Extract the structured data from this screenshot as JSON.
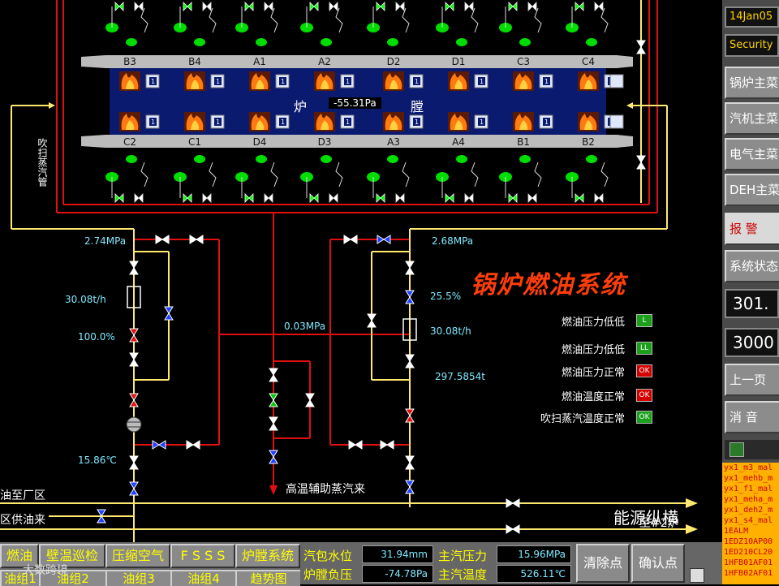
{
  "title": "锅炉燃油系统",
  "furnace": {
    "label_left": "炉",
    "label_right": "膛",
    "pressure": "-55.31Pa",
    "top_burners": [
      "B3",
      "B4",
      "A1",
      "A2",
      "D2",
      "D1",
      "C3",
      "C4"
    ],
    "bottom_burners": [
      "C2",
      "C1",
      "D4",
      "D3",
      "A3",
      "A4",
      "B1",
      "B2"
    ],
    "burner_value": "1"
  },
  "labels": {
    "purge_pipe": "吹扫蒸汽管",
    "aux_steam": "高温辅助蒸汽来",
    "to_plant": "油至厂区",
    "oil_supply": "区供油来",
    "to_boiler2": "至#2炉"
  },
  "readings": {
    "left_pressure": "2.74MPa",
    "left_flow": "30.08t/h",
    "left_valve_pct": "100.0%",
    "left_temp": "15.86℃",
    "mid_pressure": "0.03MPa",
    "right_pressure": "2.68MPa",
    "right_valve_pct": "25.5%",
    "right_flow": "30.08t/h",
    "right_total": "297.5854t"
  },
  "alarms": [
    {
      "text": "燃油压力低低",
      "badge": "L",
      "color": "#1aa01a"
    },
    {
      "text": "燃油压力低低",
      "badge": "LL",
      "color": "#1aa01a"
    },
    {
      "text": "燃油压力正常",
      "badge": "OK",
      "color": "#d40000"
    },
    {
      "text": "燃油温度正常",
      "badge": "OK",
      "color": "#d40000"
    },
    {
      "text": "吹扫蒸汽温度正常",
      "badge": "OK",
      "color": "#1aa01a"
    }
  ],
  "right_panel": {
    "date": "14Jan05",
    "security": "Security",
    "buttons": [
      "锅炉主菜",
      "汽机主菜",
      "电气主菜",
      "DEH主菜"
    ],
    "alarm_btn": "报  警",
    "status_btn": "系统状态",
    "value1": "301.",
    "value2": "3000",
    "prev_btn": "上一页",
    "silence_btn": "消  音",
    "events": [
      "yx1_m3_mal",
      "yx1_mehb_m",
      "yx1_f1_mal",
      "yx1_meha_m",
      "yx1_deh2_m",
      "yx1_s4_mal",
      "1EALM",
      "1EDZ10AP00",
      "1ED210CL20",
      "1HFB01AF01",
      "1HFB02AF01"
    ]
  },
  "bottom": {
    "btn1": "燃油",
    "btn2": "壁温巡检",
    "btn3": "压缩空气",
    "btn4": "F S S S",
    "btn5": "炉膛系统",
    "row2": [
      "油组1",
      "油组2",
      "油组3",
      "油组4",
      "趋势图"
    ],
    "drum_level_label": "汽包水位",
    "drum_level": "31.94mm",
    "furnace_press_label": "炉膛负压",
    "furnace_press": "-74.78Pa",
    "main_steam_press_label": "主汽压力",
    "main_steam_press": "15.96MPa",
    "main_steam_temp_label": "主汽温度",
    "main_steam_temp": "526.11℃",
    "clear_btn": "清除点",
    "confirm_btn": "确认点"
  },
  "watermark": "能源纵横",
  "watermark2": "大数跨境"
}
